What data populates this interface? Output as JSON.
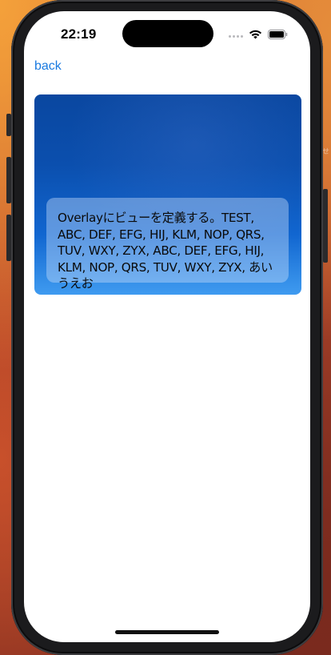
{
  "status_bar": {
    "time": "22:19"
  },
  "nav": {
    "back_label": "back"
  },
  "card": {
    "overlay_text": "Overlayにビューを定義する。TEST, ABC, DEF, EFG, HIJ, KLM, NOP, QRS, TUV, WXY, ZYX, ABC, DEF, EFG, HIJ, KLM, NOP, QRS, TUV, WXY, ZYX, あいうえお"
  },
  "icons": {
    "signal": "cellular-signal-icon",
    "wifi": "wifi-icon",
    "battery": "battery-icon"
  },
  "colors": {
    "accent": "#1a7ae0",
    "card_top": "#0a47a0",
    "card_bottom": "#3f9bf0"
  }
}
